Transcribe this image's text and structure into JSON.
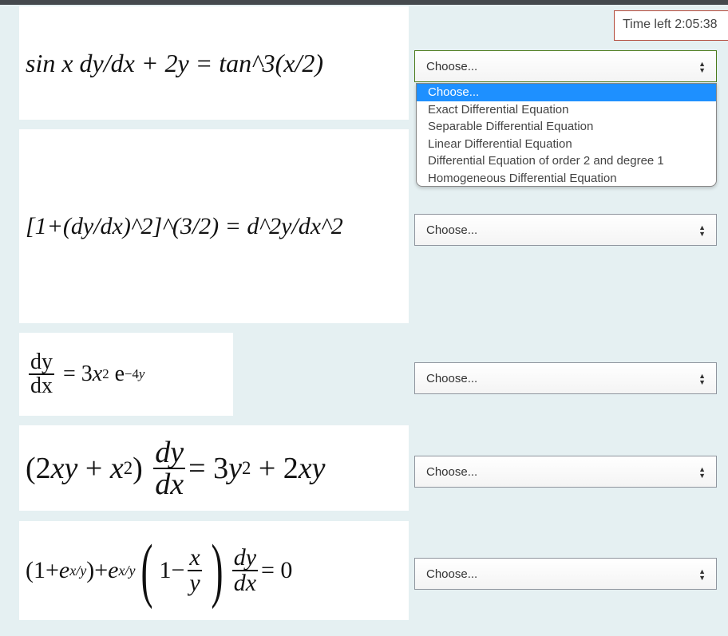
{
  "timer": {
    "label": "Time left 2:05:38"
  },
  "questions": [
    {
      "equation": "sin x dy/dx + 2y = tan^3(x/2)",
      "selected": "Choose..."
    },
    {
      "equation": "[1+(dy/dx)^2]^(3/2) = d^2y/dx^2",
      "selected": "Choose..."
    },
    {
      "equation": "dy/dx = 3x^2 e^(-4y)",
      "selected": "Choose..."
    },
    {
      "equation": "(2xy + x^2) dy/dx = 3y^2 + 2xy",
      "selected": "Choose..."
    },
    {
      "equation": "(1+e^(x/y)) + e^(x/y)(1 - x/y) dy/dx = 0",
      "selected": "Choose..."
    }
  ],
  "dropdown": {
    "options": [
      "Choose...",
      "Exact Differential Equation",
      "Separable Differential Equation",
      "Linear Differential Equation",
      "Differential Equation of order 2 and degree 1",
      "Homogeneous Differential Equation"
    ],
    "highlighted": 0
  },
  "colors": {
    "highlight": "#1e90ff",
    "background": "#e5f0f2",
    "timer_border": "#b34a3a"
  }
}
